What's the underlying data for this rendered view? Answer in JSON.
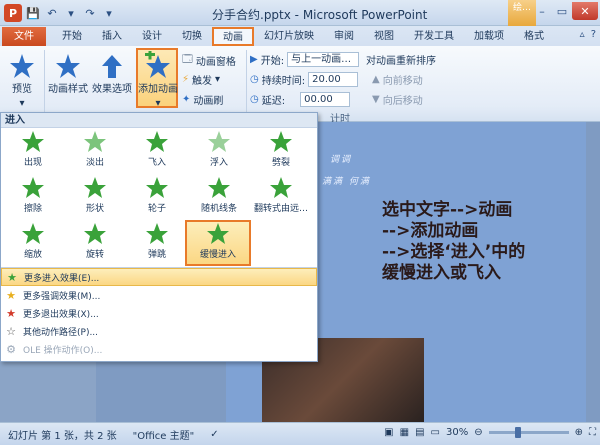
{
  "window": {
    "title": "分手合约.pptx - Microsoft PowerPoint",
    "app_icon": "P",
    "context_tab": "绘…"
  },
  "tabs": [
    {
      "label": "文件"
    },
    {
      "label": "开始"
    },
    {
      "label": "插入"
    },
    {
      "label": "设计"
    },
    {
      "label": "切换"
    },
    {
      "label": "动画"
    },
    {
      "label": "幻灯片放映"
    },
    {
      "label": "审阅"
    },
    {
      "label": "视图"
    },
    {
      "label": "开发工具"
    },
    {
      "label": "加载项"
    },
    {
      "label": "格式"
    }
  ],
  "ribbon": {
    "preview": "预览",
    "anim_style": "动画样式",
    "effect_options": "效果选项",
    "add_anim": "添加动画",
    "anim_pane": "动画窗格",
    "trigger": "触发",
    "anim_painter": "动画刷",
    "start_label": "开始:",
    "start_value": "与上一动画…",
    "duration_label": "持续时间:",
    "duration_value": "20.00",
    "delay_label": "延迟:",
    "delay_value": "00.00",
    "reorder": "对动画重新排序",
    "move_earlier": "向前移动",
    "move_later": "向后移动",
    "timing_group": "计时"
  },
  "gallery": {
    "header": "进入",
    "items": [
      {
        "label": "出现"
      },
      {
        "label": "淡出"
      },
      {
        "label": "飞入"
      },
      {
        "label": "浮入"
      },
      {
        "label": "劈裂"
      },
      {
        "label": "擦除"
      },
      {
        "label": "形状"
      },
      {
        "label": "轮子"
      },
      {
        "label": "随机线条"
      },
      {
        "label": "翻转式由远…"
      },
      {
        "label": "缩放"
      },
      {
        "label": "旋转"
      },
      {
        "label": "弹跳"
      },
      {
        "label": "缓慢进入"
      }
    ],
    "menu": [
      {
        "label": "更多进入效果(E)..."
      },
      {
        "label": "更多强调效果(M)..."
      },
      {
        "label": "更多退出效果(X)..."
      },
      {
        "label": "其他动作路径(P)..."
      },
      {
        "label": "OLE 操作动作(O)..."
      }
    ]
  },
  "annotation": {
    "line1": "选中文字-->动画",
    "line2": "-->添加动画",
    "line3": "-->选择‘进入’中的",
    "line4": "缓慢进入或飞入"
  },
  "slide": {
    "text1": "调调",
    "text2": "满满  何满"
  },
  "statusbar": {
    "slide_info": "幻灯片 第 1 张，共 2 张",
    "theme": "\"Office 主题\"",
    "zoom": "30%"
  },
  "colors": {
    "accent": "#e87a2a",
    "file_tab": "#d24726",
    "star_green": "#3aa23a"
  }
}
